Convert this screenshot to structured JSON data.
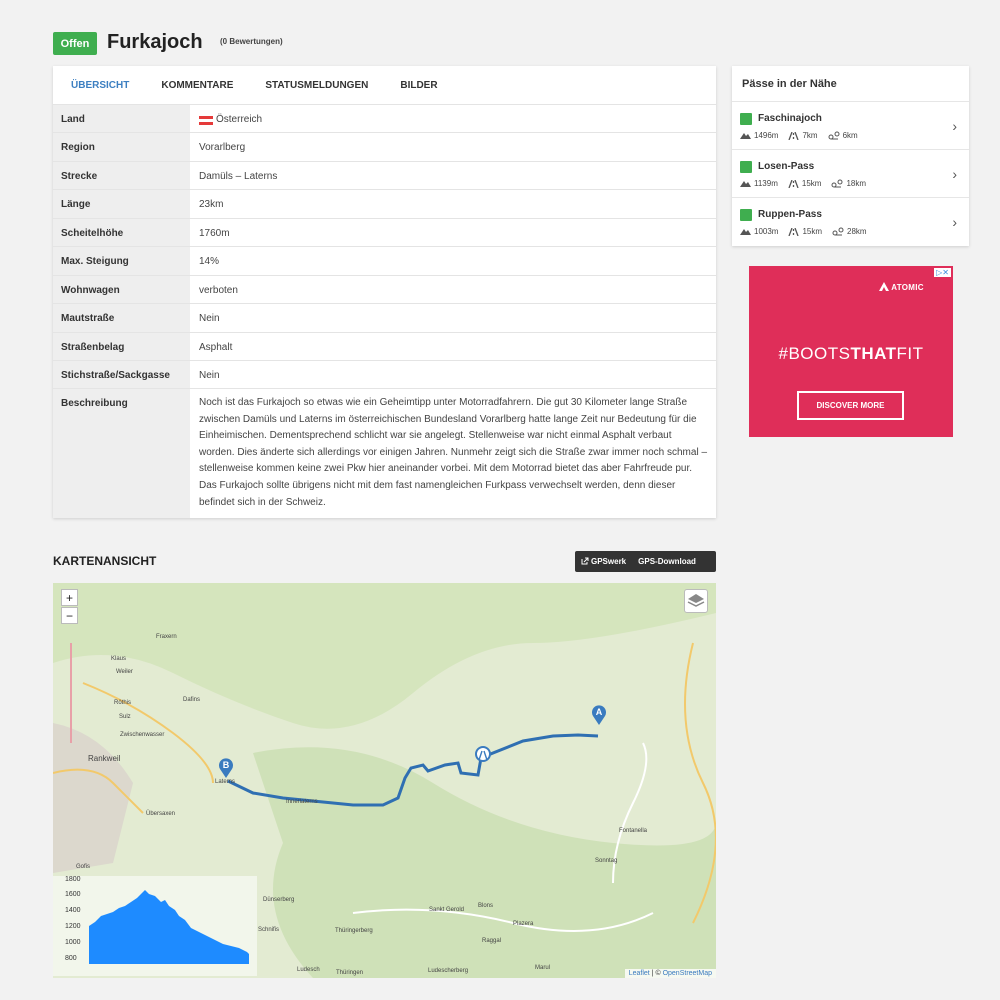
{
  "header": {
    "status": "Offen",
    "title": "Furkajoch",
    "ratings": "(0 Bewertungen)"
  },
  "tabs": [
    "ÜBERSICHT",
    "KOMMENTARE",
    "STATUSMELDUNGEN",
    "BILDER"
  ],
  "details": [
    {
      "label": "Land",
      "value": "Österreich"
    },
    {
      "label": "Region",
      "value": "Vorarlberg"
    },
    {
      "label": "Strecke",
      "value": "Damüls – Laterns"
    },
    {
      "label": "Länge",
      "value": "23km"
    },
    {
      "label": "Scheitelhöhe",
      "value": "1760m"
    },
    {
      "label": "Max. Steigung",
      "value": "14%"
    },
    {
      "label": "Wohnwagen",
      "value": "verboten"
    },
    {
      "label": "Mautstraße",
      "value": "Nein"
    },
    {
      "label": "Straßenbelag",
      "value": "Asphalt"
    },
    {
      "label": "Stichstraße/Sackgasse",
      "value": "Nein"
    },
    {
      "label": "Beschreibung",
      "value": "Noch ist das Furkajoch so etwas wie ein Geheimtipp unter Motorradfahrern. Die gut 30 Kilometer lange Straße zwischen Damüls und Laterns im österreichischen Bundesland Vorarlberg hatte lange Zeit nur Bedeutung für die Einheimischen. Dementsprechend schlicht war sie angelegt. Stellenweise war nicht einmal Asphalt verbaut worden. Dies änderte sich allerdings vor einigen Jahren. Nunmehr zeigt sich die Straße zwar immer noch schmal – stellenweise kommen keine zwei Pkw hier aneinander vorbei. Mit dem Motorrad bietet das aber Fahrfreude pur. Das Furkajoch sollte übrigens nicht mit dem fast namengleichen Furkpass verwechselt werden, denn dieser befindet sich in der Schweiz."
    }
  ],
  "nearby": {
    "title": "Pässe in der Nähe",
    "passes": [
      {
        "name": "Faschinajoch",
        "height": "1496m",
        "length": "7km",
        "distance": "6km"
      },
      {
        "name": "Losen-Pass",
        "height": "1139m",
        "length": "15km",
        "distance": "18km"
      },
      {
        "name": "Ruppen-Pass",
        "height": "1003m",
        "length": "15km",
        "distance": "28km"
      }
    ]
  },
  "ad": {
    "brand": "ATOMIC",
    "headline_a": "#BOOTS",
    "headline_b": "THAT",
    "headline_c": "FIT",
    "cta": "DISCOVER MORE",
    "close": "▷✕"
  },
  "map": {
    "title": "KARTENANSICHT",
    "gps_button": "GPSwerk",
    "download_button": "GPS-Download",
    "zoom_in": "+",
    "zoom_out": "−",
    "marker_a": "A",
    "marker_b": "B",
    "attribution_a": "Leaflet",
    "attribution_sep": " | © ",
    "attribution_b": "OpenStreetMap",
    "elevation_ticks": [
      "1800",
      "1600",
      "1400",
      "1200",
      "1000",
      "800"
    ],
    "places": [
      "Fraxern",
      "Klaus",
      "Weiler",
      "Röthis",
      "Sulz",
      "Zwischenwasser",
      "Rankweil",
      "Dafins",
      "Übersaxen",
      "Gofis",
      "Laterns",
      "Innerlaterns",
      "Fontanella",
      "Sonntag",
      "Sankt Gerold",
      "Blons",
      "Raggal",
      "Thüringerberg",
      "Dünserberg",
      "Schnifis",
      "Ludesch",
      "Marul",
      "Plazera",
      "Ludescherberg",
      "Thüringen"
    ]
  }
}
